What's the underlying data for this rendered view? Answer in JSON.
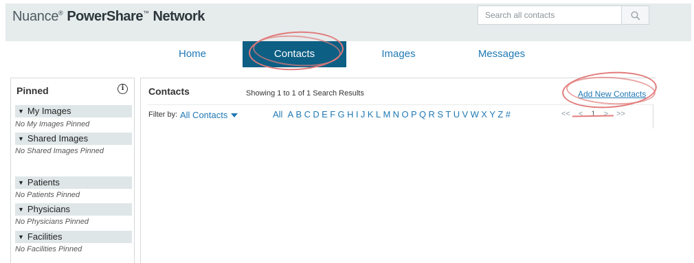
{
  "header": {
    "brand_light": "Nuance",
    "brand_bold": "PowerShare",
    "brand_tail": "Network",
    "reg_mark": "®",
    "tm_mark": "™",
    "search_placeholder": "Search all contacts"
  },
  "nav": {
    "tabs": [
      {
        "label": "Home",
        "active": false
      },
      {
        "label": "Contacts",
        "active": true
      },
      {
        "label": "Images",
        "active": false
      },
      {
        "label": "Messages",
        "active": false
      }
    ]
  },
  "sidebar": {
    "title": "Pinned",
    "info_glyph": "i",
    "sections": [
      {
        "label": "My Images",
        "empty": "No My Images Pinned"
      },
      {
        "label": "Shared Images",
        "empty": "No Shared Images Pinned"
      },
      {
        "label": "Patients",
        "empty": "No Patients Pinned"
      },
      {
        "label": "Physicians",
        "empty": "No Physicians Pinned"
      },
      {
        "label": "Facilities",
        "empty": "No Facilities Pinned"
      }
    ]
  },
  "main": {
    "title": "Contacts",
    "results": "Showing 1 to 1 of 1 Search Results",
    "add_link": "Add New Contacts",
    "filter_label": "Filter by:",
    "filter_value": "All Contacts",
    "alphabet": [
      "All",
      "A",
      "B",
      "C",
      "D",
      "E",
      "F",
      "G",
      "H",
      "I",
      "J",
      "K",
      "L",
      "M",
      "N",
      "O",
      "P",
      "Q",
      "R",
      "S",
      "T",
      "U",
      "V",
      "W",
      "X",
      "Y",
      "Z",
      "#"
    ],
    "pager": {
      "first": "<<",
      "prev": "<",
      "page": "1",
      "next": ">",
      "last": ">>"
    }
  },
  "colors": {
    "accent": "#1f78b4",
    "active_tab": "#0d5f84",
    "header_band": "#e6ebec",
    "annotation": "#e27a7a"
  }
}
